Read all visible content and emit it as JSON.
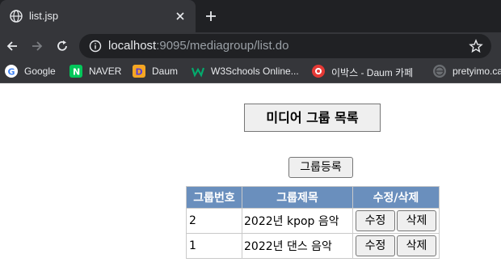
{
  "browser": {
    "tab_title": "list.jsp",
    "url_host": "localhost",
    "url_rest": ":9095/mediagroup/list.do",
    "bookmarks": [
      {
        "label": "Google",
        "color": "#4285f4"
      },
      {
        "label": "NAVER",
        "color": "#03c75a"
      },
      {
        "label": "Daum",
        "color": "#f5a623"
      },
      {
        "label": "W3Schools Online...",
        "color": "#04aa6d"
      },
      {
        "label": "이박스 - Daum 카페",
        "color": "#e53935"
      },
      {
        "label": "pretyimo.ca",
        "color": "#9aa0a6"
      }
    ]
  },
  "page": {
    "title": "미디어 그룹 목록",
    "register_button": "그룹등록",
    "table": {
      "headers": [
        "그룹번호",
        "그룹제목",
        "수정/삭제"
      ],
      "rows": [
        {
          "no": "2",
          "title": "2022년 kpop 음악",
          "edit": "수정",
          "delete": "삭제"
        },
        {
          "no": "1",
          "title": "2022년 댄스 음악",
          "edit": "수정",
          "delete": "삭제"
        }
      ]
    }
  },
  "colors": {
    "header_bg": "#6a8fbd",
    "chrome_dark": "#202124",
    "chrome_toolbar": "#35363a"
  }
}
